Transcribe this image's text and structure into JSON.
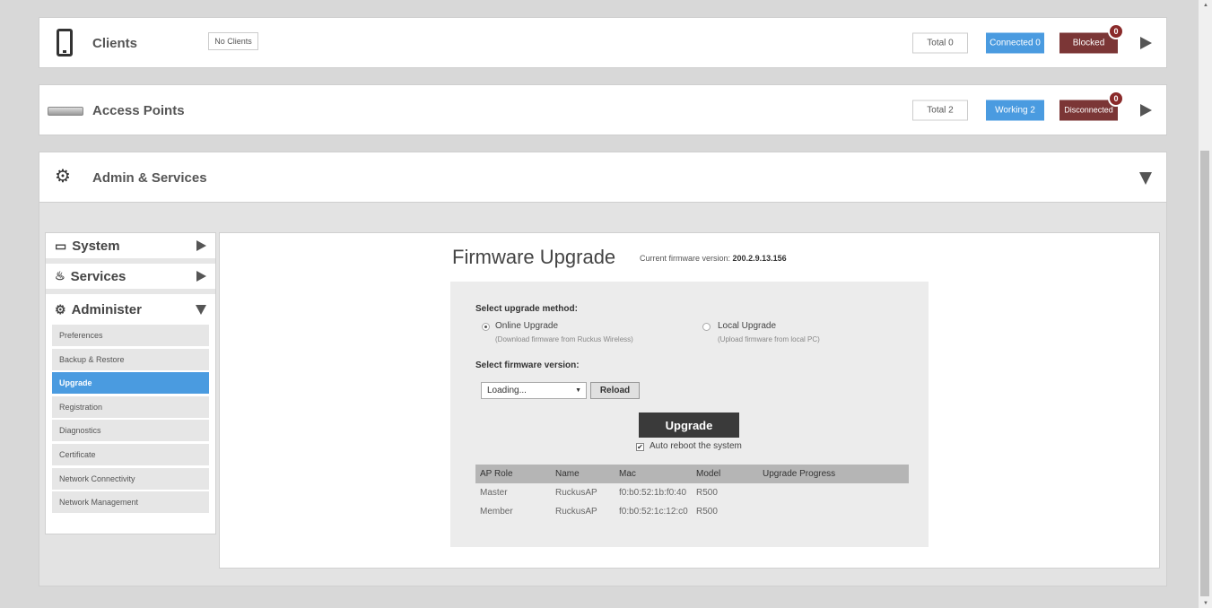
{
  "clients": {
    "title": "Clients",
    "status": "No Clients",
    "total": "Total 0",
    "connected": "Connected 0",
    "blocked": "Blocked",
    "blocked_count": "0"
  },
  "access_points": {
    "title": "Access Points",
    "total": "Total 2",
    "working": "Working 2",
    "disconnected": "Disconnected",
    "disconnected_count": "0"
  },
  "admin": {
    "title": "Admin & Services"
  },
  "sidebar": {
    "system": "System",
    "services": "Services",
    "administer": "Administer",
    "items": [
      {
        "label": "Preferences"
      },
      {
        "label": "Backup & Restore"
      },
      {
        "label": "Upgrade"
      },
      {
        "label": "Registration"
      },
      {
        "label": "Diagnostics"
      },
      {
        "label": "Certificate"
      },
      {
        "label": "Network Connectivity"
      },
      {
        "label": "Network Management"
      }
    ]
  },
  "firmware": {
    "title": "Firmware Upgrade",
    "current_label": "Current firmware version:",
    "current_value": "200.2.9.13.156",
    "method_label": "Select upgrade method:",
    "online_label": "Online Upgrade",
    "online_hint": "(Download firmware from Ruckus Wireless)",
    "local_label": "Local Upgrade",
    "local_hint": "(Upload firmware from local PC)",
    "version_label": "Select firmware version:",
    "version_value": "Loading...",
    "reload": "Reload",
    "upgrade": "Upgrade",
    "auto_reboot": "Auto reboot the system"
  },
  "ap_table": {
    "headers": [
      "AP Role",
      "Name",
      "Mac",
      "Model",
      "Upgrade Progress"
    ],
    "rows": [
      [
        "Master",
        "RuckusAP",
        "f0:b0:52:1b:f0:40",
        "R500",
        ""
      ],
      [
        "Member",
        "RuckusAP",
        "f0:b0:52:1c:12:c0",
        "R500",
        ""
      ]
    ]
  }
}
